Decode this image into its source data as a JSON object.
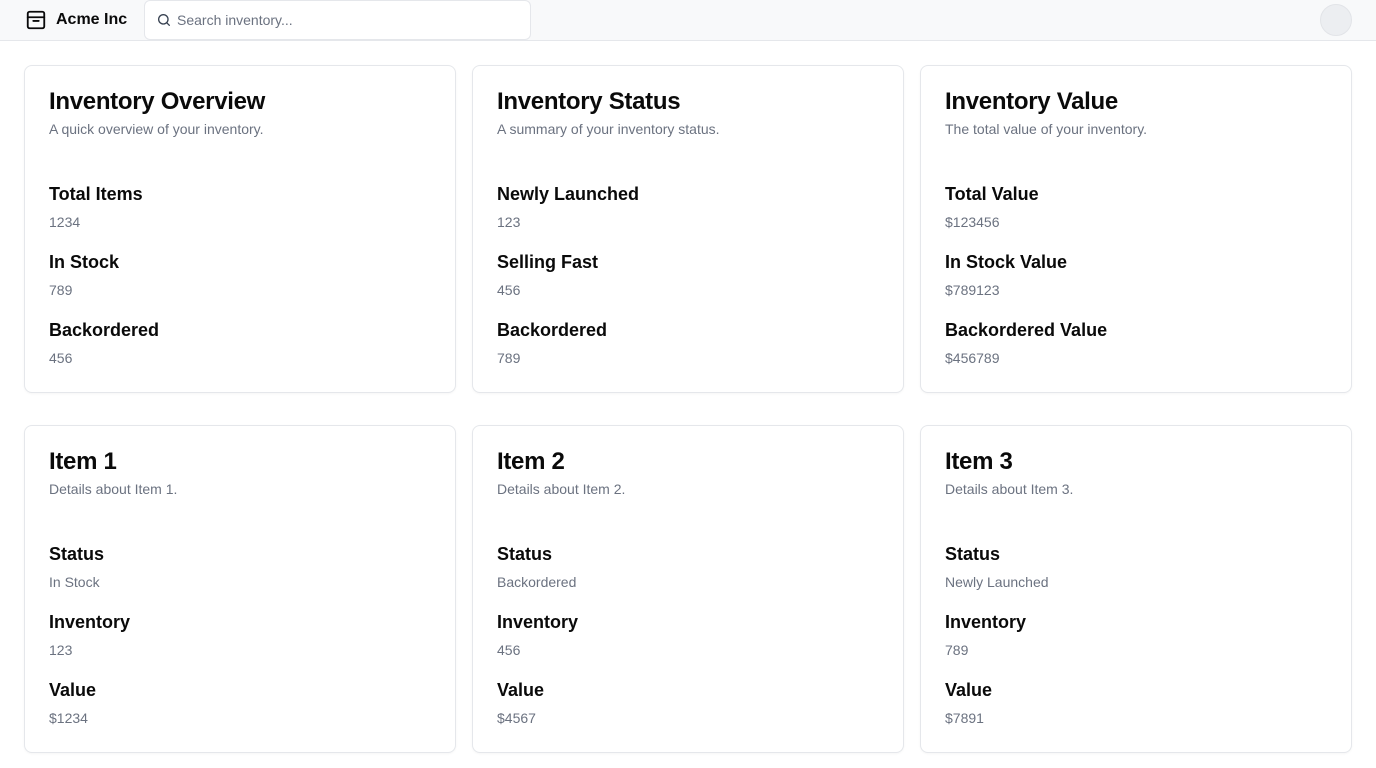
{
  "header": {
    "brand_name": "Acme Inc",
    "brand_icon": "package-icon",
    "search": {
      "placeholder": "Search inventory...",
      "value": ""
    },
    "avatar_icon": "avatar"
  },
  "cards": [
    {
      "title": "Inventory Overview",
      "description": "A quick overview of your inventory.",
      "stats": [
        {
          "label": "Total Items",
          "value": "1234"
        },
        {
          "label": "In Stock",
          "value": "789"
        },
        {
          "label": "Backordered",
          "value": "456"
        }
      ]
    },
    {
      "title": "Inventory Status",
      "description": "A summary of your inventory status.",
      "stats": [
        {
          "label": "Newly Launched",
          "value": "123"
        },
        {
          "label": "Selling Fast",
          "value": "456"
        },
        {
          "label": "Backordered",
          "value": "789"
        }
      ]
    },
    {
      "title": "Inventory Value",
      "description": "The total value of your inventory.",
      "stats": [
        {
          "label": "Total Value",
          "value": "$123456"
        },
        {
          "label": "In Stock Value",
          "value": "$789123"
        },
        {
          "label": "Backordered Value",
          "value": "$456789"
        }
      ]
    },
    {
      "title": "Item 1",
      "description": "Details about Item 1.",
      "stats": [
        {
          "label": "Status",
          "value": "In Stock"
        },
        {
          "label": "Inventory",
          "value": "123"
        },
        {
          "label": "Value",
          "value": "$1234"
        }
      ]
    },
    {
      "title": "Item 2",
      "description": "Details about Item 2.",
      "stats": [
        {
          "label": "Status",
          "value": "Backordered"
        },
        {
          "label": "Inventory",
          "value": "456"
        },
        {
          "label": "Value",
          "value": "$4567"
        }
      ]
    },
    {
      "title": "Item 3",
      "description": "Details about Item 3.",
      "stats": [
        {
          "label": "Status",
          "value": "Newly Launched"
        },
        {
          "label": "Inventory",
          "value": "789"
        },
        {
          "label": "Value",
          "value": "$7891"
        }
      ]
    }
  ]
}
